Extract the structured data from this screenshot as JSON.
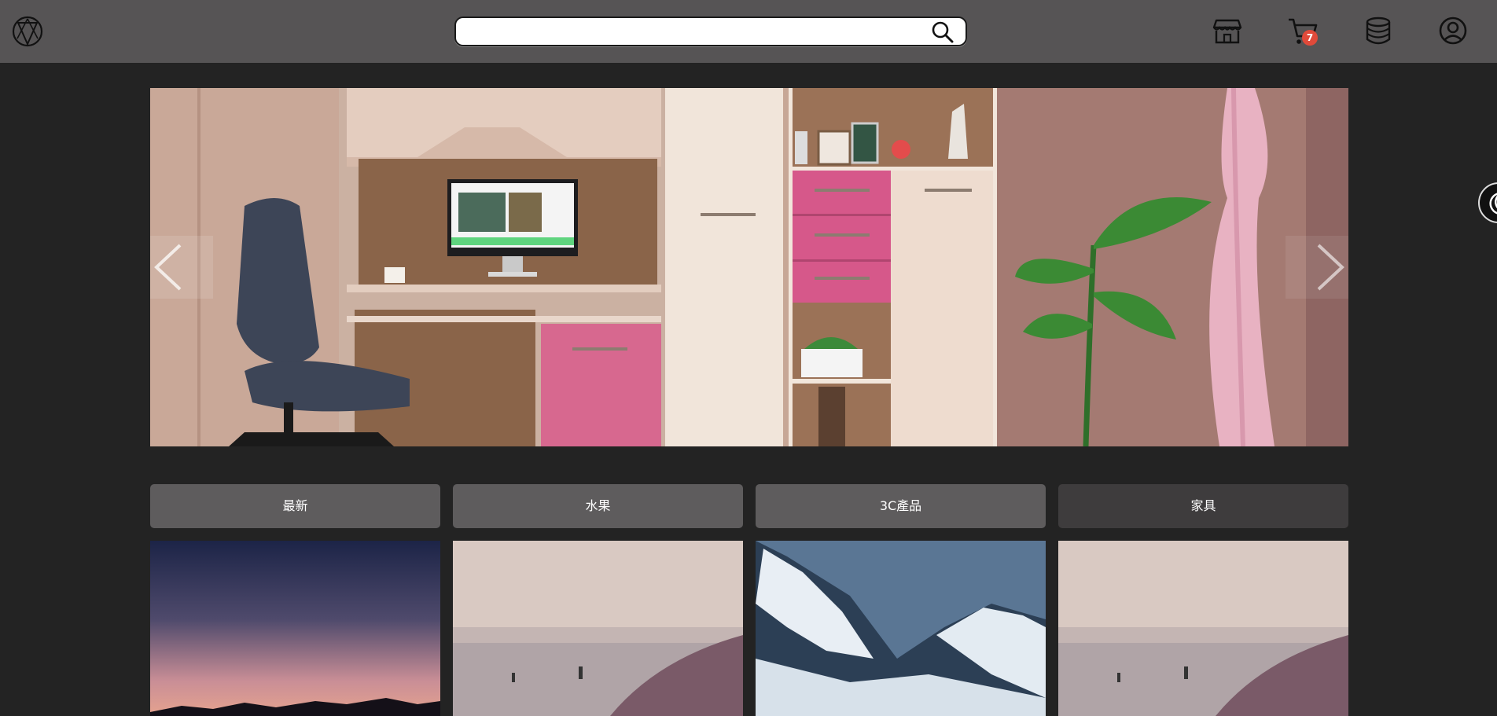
{
  "header": {
    "logo_icon": "triangle-in-circle-logo",
    "search": {
      "value": "",
      "placeholder": ""
    },
    "icons": [
      "store-icon",
      "cart-icon",
      "database-icon",
      "user-circle-icon"
    ],
    "cart_count": "7"
  },
  "carousel": {
    "prev_icon": "chevron-left-icon",
    "next_icon": "chevron-right-icon"
  },
  "theme_toggle_icon": "moon-icon",
  "tabs": [
    {
      "label": "最新"
    },
    {
      "label": "水果"
    },
    {
      "label": "3C產品"
    },
    {
      "label": "家具"
    }
  ],
  "colors": {
    "header_bg": "#565455",
    "page_bg": "#232323",
    "tab_bg": "#5e5c5d",
    "tab_active_bg": "#3e3c3d",
    "badge": "#e04a3a"
  }
}
